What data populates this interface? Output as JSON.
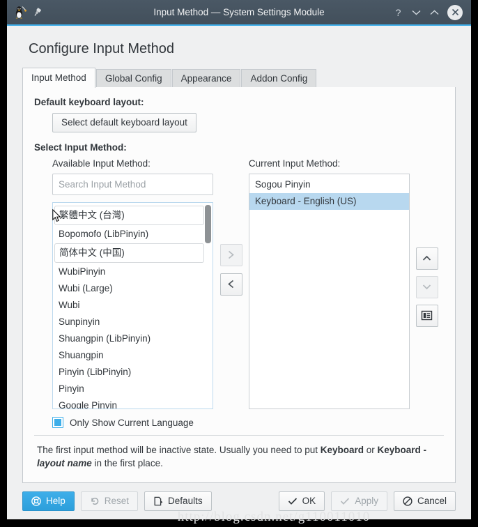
{
  "window": {
    "title": "Input Method — System Settings Module",
    "icons": {
      "app": "fcitx-penguin-icon",
      "pin": "pin-icon"
    },
    "controls": {
      "help": "?",
      "minimize": "⌄",
      "maximize": "⌃",
      "close": "✕"
    },
    "accent_color": "#3daee9",
    "titlebar_color": "#475662"
  },
  "page_title": "Configure Input Method",
  "tabs": [
    {
      "label": "Input Method",
      "active": true
    },
    {
      "label": "Global Config",
      "active": false
    },
    {
      "label": "Appearance",
      "active": false
    },
    {
      "label": "Addon Config",
      "active": false
    }
  ],
  "default_layout": {
    "label": "Default keyboard layout:",
    "button": "Select default keyboard layout"
  },
  "select_input_method_label": "Select Input Method:",
  "available": {
    "label": "Available Input Method:",
    "search_placeholder": "Search Input Method",
    "search_value": "",
    "items": [
      {
        "text": "繁體中文 (台灣)",
        "group": true
      },
      {
        "text": "Bopomofo (LibPinyin)",
        "group": false
      },
      {
        "text": "简体中文 (中国)",
        "group": true
      },
      {
        "text": "WubiPinyin",
        "group": false
      },
      {
        "text": "Wubi (Large)",
        "group": false
      },
      {
        "text": "Wubi",
        "group": false
      },
      {
        "text": "Sunpinyin",
        "group": false
      },
      {
        "text": "Shuangpin (LibPinyin)",
        "group": false
      },
      {
        "text": "Shuangpin",
        "group": false
      },
      {
        "text": "Pinyin (LibPinyin)",
        "group": false
      },
      {
        "text": "Pinyin",
        "group": false
      },
      {
        "text": "Google Pinyin",
        "group": false
      }
    ]
  },
  "current": {
    "label": "Current Input Method:",
    "items": [
      {
        "text": "Sogou Pinyin",
        "selected": false
      },
      {
        "text": "Keyboard - English (US)",
        "selected": true
      }
    ],
    "selected_color": "#b8d8ef"
  },
  "transfer_buttons": [
    {
      "icon": "chevron-right-icon",
      "glyph": "❯",
      "enabled": false
    },
    {
      "icon": "chevron-left-icon",
      "glyph": "❮",
      "enabled": true
    }
  ],
  "order_buttons": [
    {
      "icon": "chevron-up-icon",
      "glyph": "⌃",
      "enabled": true
    },
    {
      "icon": "chevron-down-icon",
      "glyph": "⌄",
      "enabled": false
    },
    {
      "icon": "configure-list-icon",
      "glyph": "▤",
      "enabled": true
    }
  ],
  "only_current_language": {
    "label": "Only Show Current Language",
    "checked": true
  },
  "hint": {
    "part1": "The first input method will be inactive state. Usually you need to put ",
    "bold1": "Keyboard",
    "part2": " or ",
    "bold2": "Keyboard - ",
    "bolditalic": "layout name",
    "part3": " in the first place."
  },
  "buttons": {
    "help": {
      "label": "Help",
      "icon": "help-buoy-icon",
      "glyph": "✤",
      "enabled": true
    },
    "reset": {
      "label": "Reset",
      "icon": "undo-arrow-icon",
      "glyph": "↺",
      "enabled": false
    },
    "defaults": {
      "label": "Defaults",
      "icon": "document-revert-icon",
      "glyph": "⇲",
      "enabled": true
    },
    "ok": {
      "label": "OK",
      "icon": "check-icon",
      "glyph": "✓",
      "enabled": true
    },
    "apply": {
      "label": "Apply",
      "icon": "check-icon",
      "glyph": "✓",
      "enabled": false
    },
    "cancel": {
      "label": "Cancel",
      "icon": "prohibition-icon",
      "glyph": "⊘",
      "enabled": true
    }
  },
  "watermark": "http://blog.csdn.net/g110011010"
}
